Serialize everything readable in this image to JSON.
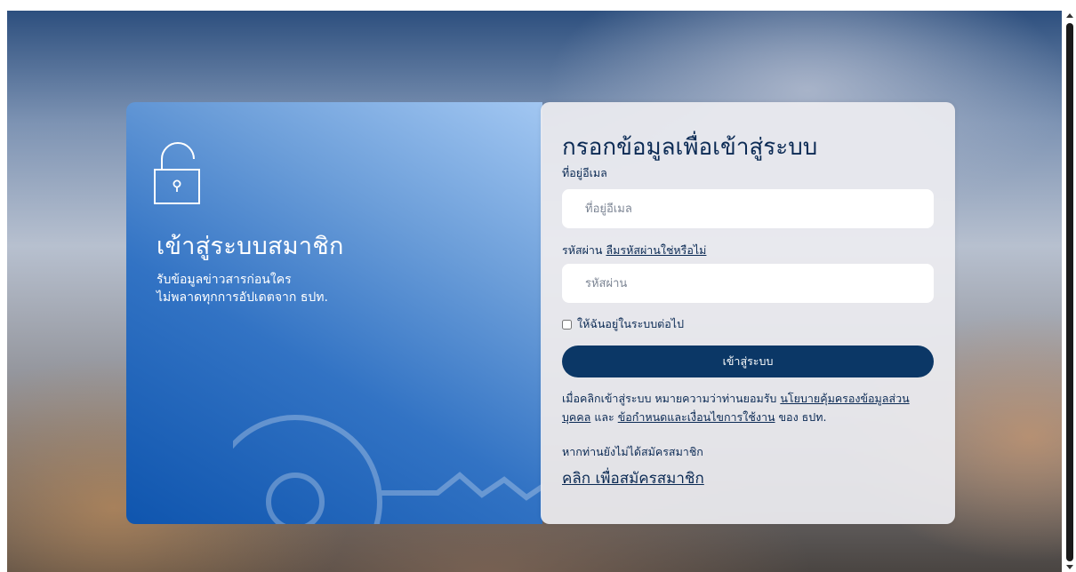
{
  "left_panel": {
    "title": "เข้าสู่ระบบสมาชิก",
    "desc_line1": "รับข้อมูลข่าวสารก่อนใคร",
    "desc_line2": "ไม่พลาดทุกการอัปเดตจาก ธปท.",
    "icons": [
      "lock-icon",
      "key-icon"
    ]
  },
  "form": {
    "title": "กรอกข้อมูลเพื่อเข้าสู่ระบบ",
    "email_label": "ที่อยู่อีเมล",
    "email_placeholder": "ที่อยู่อีเมล",
    "email_value": "",
    "password_label": "รหัสผ่าน",
    "forgot_link": "ลืมรหัสผ่านใช่หรือไม่",
    "password_placeholder": "รหัสผ่าน",
    "password_value": "",
    "remember_label": "ให้ฉันอยู่ในระบบต่อไป",
    "remember_checked": false,
    "login_button": "เข้าสู่ระบบ",
    "consent_prefix": "เมื่อคลิกเข้าสู่ระบบ หมายความว่าท่านยอมรับ",
    "privacy_link": "นโยบายคุ้มครองข้อมูลส่วนบุคคล",
    "consent_and": "และ",
    "terms_link": "ข้อกำหนดและเงื่อนไขการใช้งาน",
    "consent_suffix": "ของ ธปท.",
    "no_account_text": "หากท่านยังไม่ได้สมัครสมาชิก",
    "register_link": "คลิก เพื่อสมัครสมาชิก"
  },
  "colors": {
    "primary_navy": "#0b3766",
    "text_navy": "#0b2a54",
    "left_panel_blue": "#1b5fb5"
  }
}
